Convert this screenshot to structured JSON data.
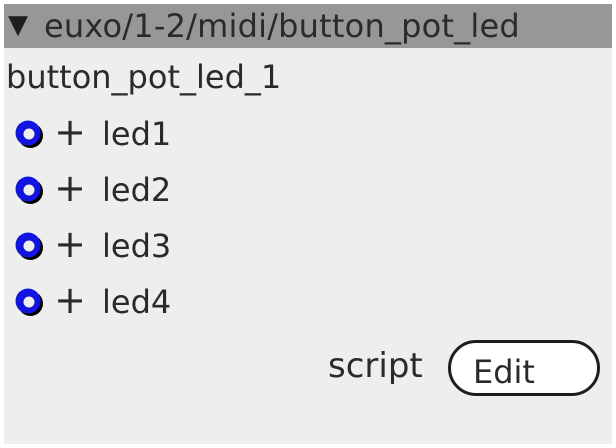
{
  "header": {
    "collapse_glyph": "▼",
    "title": "euxo/1-2/midi/button_pot_led"
  },
  "instance_name": "button_pot_led_1",
  "outputs": [
    {
      "add_glyph": "+",
      "label": "led1",
      "icon": "led-output-icon"
    },
    {
      "add_glyph": "+",
      "label": "led2",
      "icon": "led-output-icon"
    },
    {
      "add_glyph": "+",
      "label": "led3",
      "icon": "led-output-icon"
    },
    {
      "add_glyph": "+",
      "label": "led4",
      "icon": "led-output-icon"
    }
  ],
  "script": {
    "label": "script",
    "edit_button": "Edit"
  },
  "colors": {
    "panel_bg": "#eeeeee",
    "titlebar_bg": "#979797",
    "led_ring": "#1414e0",
    "led_shadow": "#000000"
  }
}
